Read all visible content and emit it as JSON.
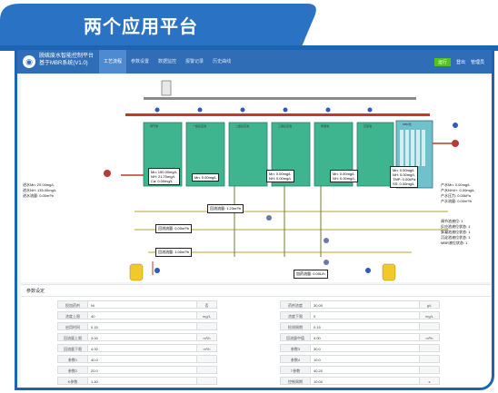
{
  "banner": {
    "title": "两个应用平台"
  },
  "app": {
    "title": "脱硫废水智能控制平台",
    "subtitle": "基于MBR系统(V1.0)",
    "menu": [
      "工艺流程",
      "参数设置",
      "数据监控",
      "报警记录",
      "历史曲线"
    ],
    "right": [
      "运行",
      "登出",
      "管理员"
    ]
  },
  "diagram": {
    "tanks": [
      "调节池",
      "一级反应池",
      "二级反应池",
      "三级反应池",
      "絮凝池",
      "沉淀池",
      "MBR池",
      "产水池"
    ],
    "left_readout": [
      "进水Mn: 20.00mg/L",
      "进水NH: 135.00mg/L",
      "进水流量: 0.00m³/h"
    ],
    "right_readout": [
      "产水Mn: 0.00mg/L",
      "产水NH4+: 0.00mg/L",
      "产水压力: 0.00kPa",
      "产水流量: 0.00m³/h"
    ],
    "right_status": [
      "调节池液位: 1",
      "反应池液位状态: 1",
      "絮凝池液位状态: 1",
      "沉淀池液位状态: 1",
      "MBR液位状态: 1"
    ],
    "tank_box_1": [
      "Mn: 150.00mg/L",
      "NH: 21.70mg/L",
      "Ca: 0.00mg/L"
    ],
    "tank_box_2": [
      "Mn: 0.00mg/L"
    ],
    "tank_box_3": [
      "Mn: 0.00mg/L",
      "NH: 0.00mg/L"
    ],
    "tank_box_4": [
      "Mn: 0.00mg/L",
      "NH: 0.00mg/L"
    ],
    "tank_box_5": [
      "Mn: 0.00mg/L",
      "NH: 0.00mg/L",
      "TMP: 0.00kPa",
      "SS: 0.00mg/L"
    ],
    "flow_1": "回流流量: 1.23m³/h",
    "flow_2": "回流流量: 0.00m³/h",
    "flow_3": "回流流量: 1.00m³/h",
    "flow_4": "加药流量: 0.00L/h"
  },
  "params": {
    "title": "参数设定",
    "left": [
      {
        "label": "投加药剂",
        "value": "Ni",
        "unit": "否"
      },
      {
        "label": "浓度上限",
        "value": "40",
        "unit": "mg/L"
      },
      {
        "label": "启用时间",
        "value": "0.15",
        "unit": ""
      },
      {
        "label": "回流量上限",
        "value": "3.00",
        "unit": "m³/h"
      },
      {
        "label": "回流量下限",
        "value": "4.00",
        "unit": "m³/h"
      },
      {
        "label": "参数1",
        "value": "40.0",
        "unit": ""
      },
      {
        "label": "参数2",
        "value": "20.0",
        "unit": ""
      },
      {
        "label": "K参数",
        "value": "1.40",
        "unit": ""
      }
    ],
    "right": [
      {
        "label": "药剂浓度",
        "value": "30.00",
        "unit": "g/L"
      },
      {
        "label": "浓度下限",
        "value": "0",
        "unit": "mg/L"
      },
      {
        "label": "检测周期",
        "value": "0.15",
        "unit": ""
      },
      {
        "label": "回流量中值",
        "value": "4.00",
        "unit": "m³/h"
      },
      {
        "label": "参数3",
        "value": "30.0",
        "unit": ""
      },
      {
        "label": "参数4",
        "value": "10.0",
        "unit": ""
      },
      {
        "label": "T参数",
        "value": "40.20",
        "unit": ""
      },
      {
        "label": "控制周期",
        "value": "10.00",
        "unit": "s"
      }
    ]
  }
}
